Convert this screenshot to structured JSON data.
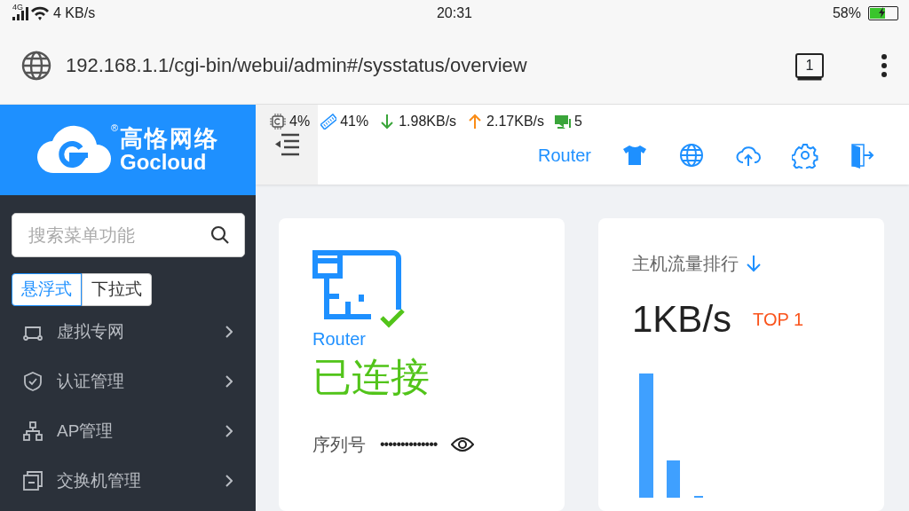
{
  "status_bar": {
    "network": "4G",
    "speed": "4 KB/s",
    "time": "20:31",
    "battery": "58%",
    "level": 0.58,
    "charging": true
  },
  "address_bar": {
    "url": "192.168.1.1/cgi-bin/webui/admin#/sysstatus/overview",
    "tab_count": "1"
  },
  "logo": {
    "name_cn": "高恪网络",
    "name_en": "Gocloud",
    "registered_mark": "®"
  },
  "header": {
    "stats": [
      {
        "kind": "cpu",
        "text": "4%"
      },
      {
        "kind": "memory",
        "text": "41%"
      },
      {
        "kind": "download",
        "text": "1.98KB/s"
      },
      {
        "kind": "upload",
        "text": "2.17KB/s"
      },
      {
        "kind": "clients",
        "text": "5"
      }
    ],
    "mode": "Router",
    "actions": [
      {
        "kind": "theme"
      },
      {
        "kind": "globe"
      },
      {
        "kind": "upload"
      },
      {
        "kind": "settings"
      },
      {
        "kind": "logout"
      }
    ]
  },
  "sidebar": {
    "search": {
      "placeholder": "搜索菜单功能"
    },
    "menu_styles": [
      {
        "label": "悬浮式",
        "selected": true
      },
      {
        "label": "下拉式",
        "selected": false
      }
    ],
    "items": [
      {
        "kind": "vpn",
        "label": "虚拟专网"
      },
      {
        "kind": "auth",
        "label": "认证管理"
      },
      {
        "kind": "ap",
        "label": "AP管理"
      },
      {
        "kind": "switch",
        "label": "交换机管理"
      }
    ]
  },
  "device_card": {
    "device": "Router",
    "status": "已连接",
    "serial_label": "序列号",
    "serial_value": "••••••••••••••"
  },
  "traffic_card": {
    "title": "主机流量排行",
    "value": "1KB/s",
    "rank": "TOP 1"
  }
}
